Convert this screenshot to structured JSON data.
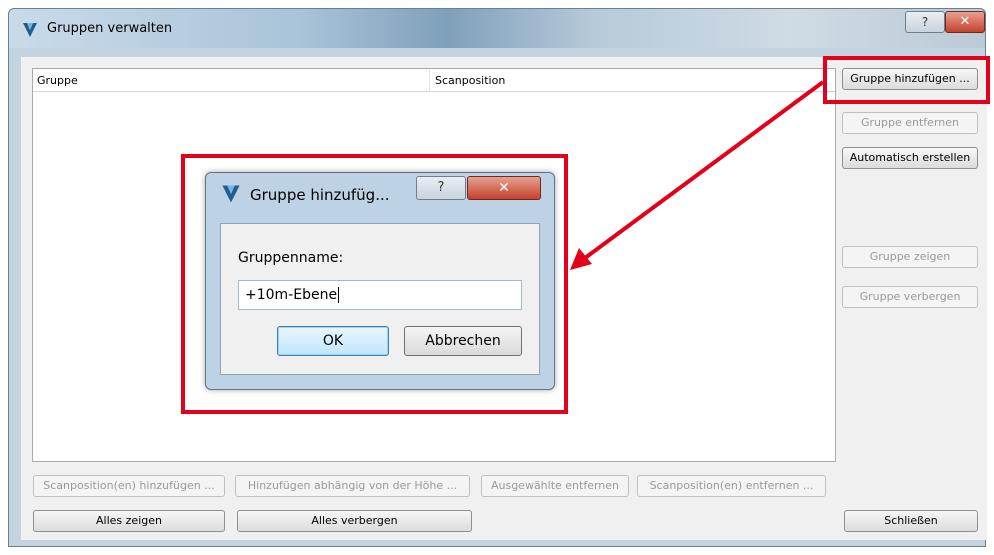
{
  "window": {
    "title": "Gruppen verwalten",
    "help_glyph": "?",
    "close_glyph": "✕"
  },
  "table": {
    "columns": [
      "Gruppe",
      "Scanposition"
    ]
  },
  "side_buttons": {
    "add": "Gruppe hinzufügen ...",
    "remove": "Gruppe entfernen",
    "auto": "Automatisch erstellen",
    "show": "Gruppe zeigen",
    "hide": "Gruppe verbergen"
  },
  "bottom_buttons": {
    "scan_add": "Scanposition(en) hinzufügen ...",
    "add_height": "Hinzufügen abhängig von der Höhe ...",
    "remove_selected": "Ausgewählte entfernen",
    "scan_remove": "Scanposition(en) entfernen ...",
    "show_all": "Alles zeigen",
    "hide_all": "Alles verbergen",
    "close": "Schließen"
  },
  "dialog": {
    "title": "Gruppe hinzufüg...",
    "help_glyph": "?",
    "close_glyph": "✕",
    "label": "Gruppenname:",
    "input_value": "+10m-Ebene",
    "ok": "OK",
    "cancel": "Abbrechen"
  },
  "colors": {
    "highlight": "#e3001b",
    "logo": "#1f5e8e"
  }
}
